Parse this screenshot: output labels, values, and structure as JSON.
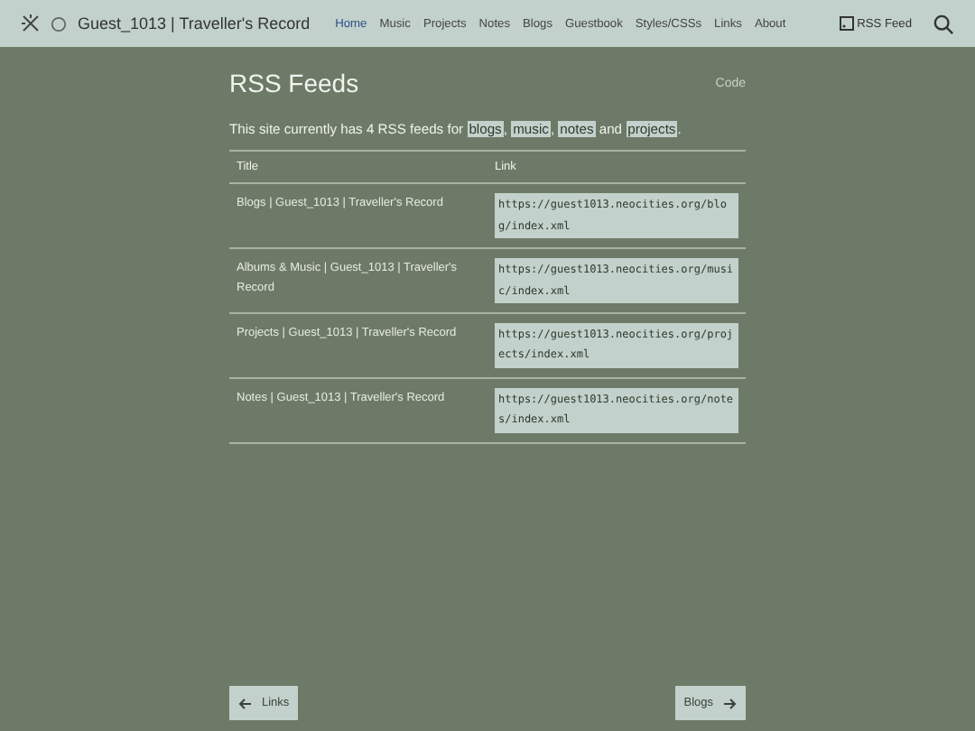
{
  "site_title": "Guest_1013 | Traveller's Record",
  "nav": [
    {
      "label": "Home",
      "selected": true
    },
    {
      "label": "Music",
      "selected": false
    },
    {
      "label": "Projects",
      "selected": false
    },
    {
      "label": "Notes",
      "selected": false
    },
    {
      "label": "Blogs",
      "selected": false
    },
    {
      "label": "Guestbook",
      "selected": false
    },
    {
      "label": "Styles/CSSs",
      "selected": false
    },
    {
      "label": "Links",
      "selected": false
    },
    {
      "label": "About",
      "selected": false
    }
  ],
  "rss_link": "RSS Feed",
  "heading": "RSS Feeds",
  "code_link": "Code",
  "intro": {
    "text": "This site currently has 4 RSS feeds for",
    "links": [
      "blogs",
      "music",
      "notes",
      "projects"
    ],
    "separators": [
      ",",
      ",",
      "and",
      "."
    ]
  },
  "table": {
    "columns": [
      "Title",
      "Link"
    ],
    "rows": [
      {
        "title": "Blogs | Guest_1013 | Traveller's Record",
        "link": "https://guest1013.neocities.org/blog/index.xml"
      },
      {
        "title": "Albums & Music | Guest_1013 | Traveller's Record",
        "link": "https://guest1013.neocities.org/music/index.xml"
      },
      {
        "title": "Projects | Guest_1013 | Traveller's Record",
        "link": "https://guest1013.neocities.org/projects/index.xml"
      },
      {
        "title": "Notes | Guest_1013 | Traveller's Record",
        "link": "https://guest1013.neocities.org/notes/index.xml"
      }
    ]
  },
  "pager": {
    "prev": "Links",
    "next": "Blogs"
  }
}
